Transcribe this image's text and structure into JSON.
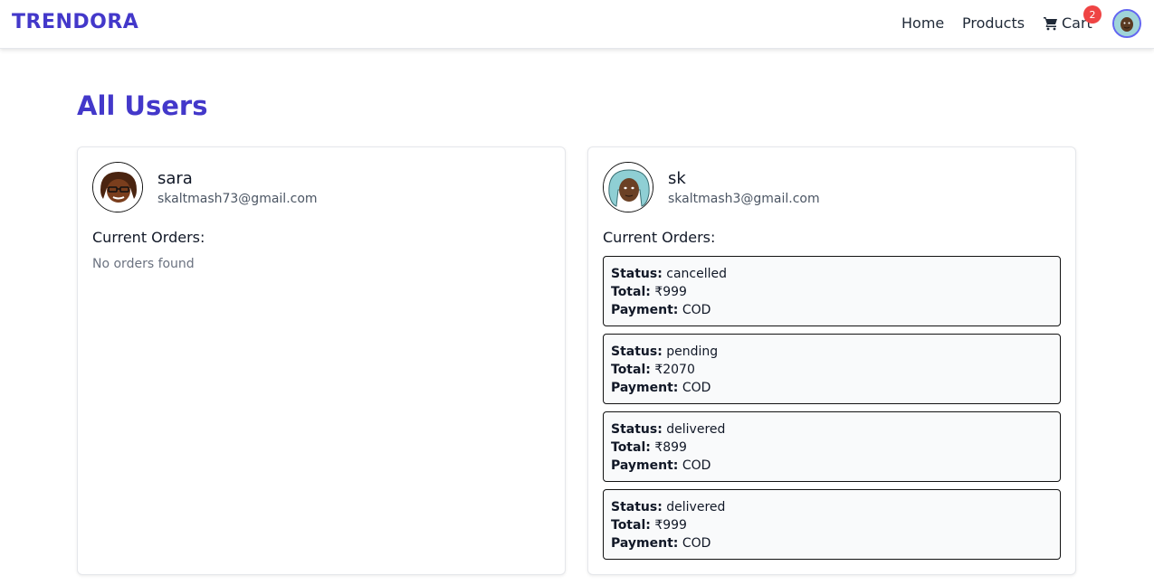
{
  "nav": {
    "brand": "TRENDORA",
    "home": "Home",
    "products": "Products",
    "cart": "Cart",
    "cart_count": "2"
  },
  "page": {
    "title": "All Users"
  },
  "labels": {
    "current_orders": "Current Orders:",
    "no_orders": "No orders found",
    "status": "Status:",
    "total": "Total:",
    "payment": "Payment:"
  },
  "users": [
    {
      "name": "sara",
      "email": "skaltmash73@gmail.com",
      "orders": []
    },
    {
      "name": "sk",
      "email": "skaltmash3@gmail.com",
      "orders": [
        {
          "status": "cancelled",
          "total": "₹999",
          "payment": "COD"
        },
        {
          "status": "pending",
          "total": "₹2070",
          "payment": "COD"
        },
        {
          "status": "delivered",
          "total": "₹899",
          "payment": "COD"
        },
        {
          "status": "delivered",
          "total": "₹999",
          "payment": "COD"
        }
      ]
    }
  ],
  "colors": {
    "brand": "#4338ca",
    "badge": "#ef4444"
  }
}
